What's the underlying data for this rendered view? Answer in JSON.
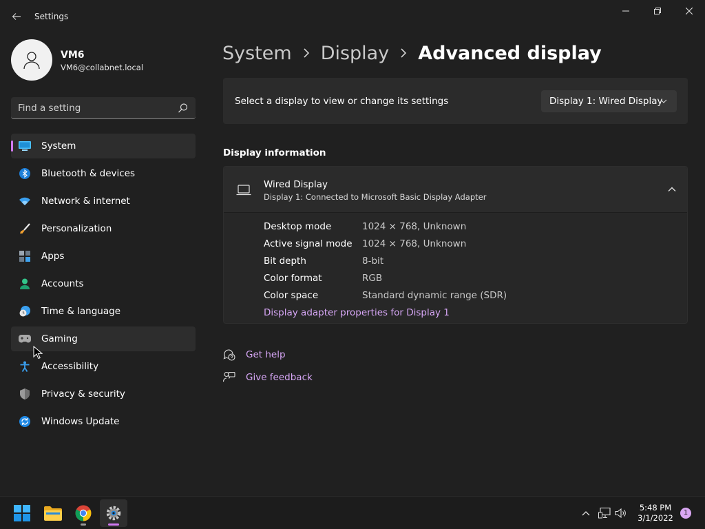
{
  "window": {
    "title": "Settings",
    "minimize_glyph": "—",
    "maximize_glyph": "❐",
    "close_glyph": "✕"
  },
  "user": {
    "name": "VM6",
    "email": "VM6@collabnet.local"
  },
  "search": {
    "placeholder": "Find a setting"
  },
  "nav": {
    "items": [
      {
        "label": "System",
        "icon": "system-icon"
      },
      {
        "label": "Bluetooth & devices",
        "icon": "bluetooth-icon"
      },
      {
        "label": "Network & internet",
        "icon": "wifi-icon"
      },
      {
        "label": "Personalization",
        "icon": "brush-icon"
      },
      {
        "label": "Apps",
        "icon": "apps-icon"
      },
      {
        "label": "Accounts",
        "icon": "person-icon"
      },
      {
        "label": "Time & language",
        "icon": "clock-globe-icon"
      },
      {
        "label": "Gaming",
        "icon": "gamepad-icon"
      },
      {
        "label": "Accessibility",
        "icon": "accessibility-icon"
      },
      {
        "label": "Privacy & security",
        "icon": "shield-icon"
      },
      {
        "label": "Windows Update",
        "icon": "update-icon"
      }
    ],
    "selected": "System",
    "hovered": "Gaming"
  },
  "breadcrumb": {
    "items": [
      "System",
      "Display",
      "Advanced display"
    ]
  },
  "display_select": {
    "label": "Select a display to view or change its settings",
    "value": "Display 1: Wired Display"
  },
  "display_info": {
    "section_title": "Display information",
    "display_name": "Wired Display",
    "display_sub": "Display 1: Connected to Microsoft Basic Display Adapter",
    "properties": [
      {
        "name": "Desktop mode",
        "value": "1024 × 768, Unknown"
      },
      {
        "name": "Active signal mode",
        "value": "1024 × 768, Unknown"
      },
      {
        "name": "Bit depth",
        "value": "8-bit"
      },
      {
        "name": "Color format",
        "value": "RGB"
      },
      {
        "name": "Color space",
        "value": "Standard dynamic range (SDR)"
      }
    ],
    "adapter_link": "Display adapter properties for Display 1"
  },
  "help": {
    "get_help": "Get help",
    "give_feedback": "Give feedback"
  },
  "taskbar": {
    "apps": [
      "windows-start-icon",
      "file-explorer-icon",
      "chrome-icon",
      "settings-icon"
    ],
    "time": "5:48 PM",
    "date": "3/1/2022",
    "notification_count": "1"
  },
  "colors": {
    "accent": "#d179f2",
    "link": "#d6a6f5",
    "background": "#202020",
    "card": "#2b2b2b"
  }
}
